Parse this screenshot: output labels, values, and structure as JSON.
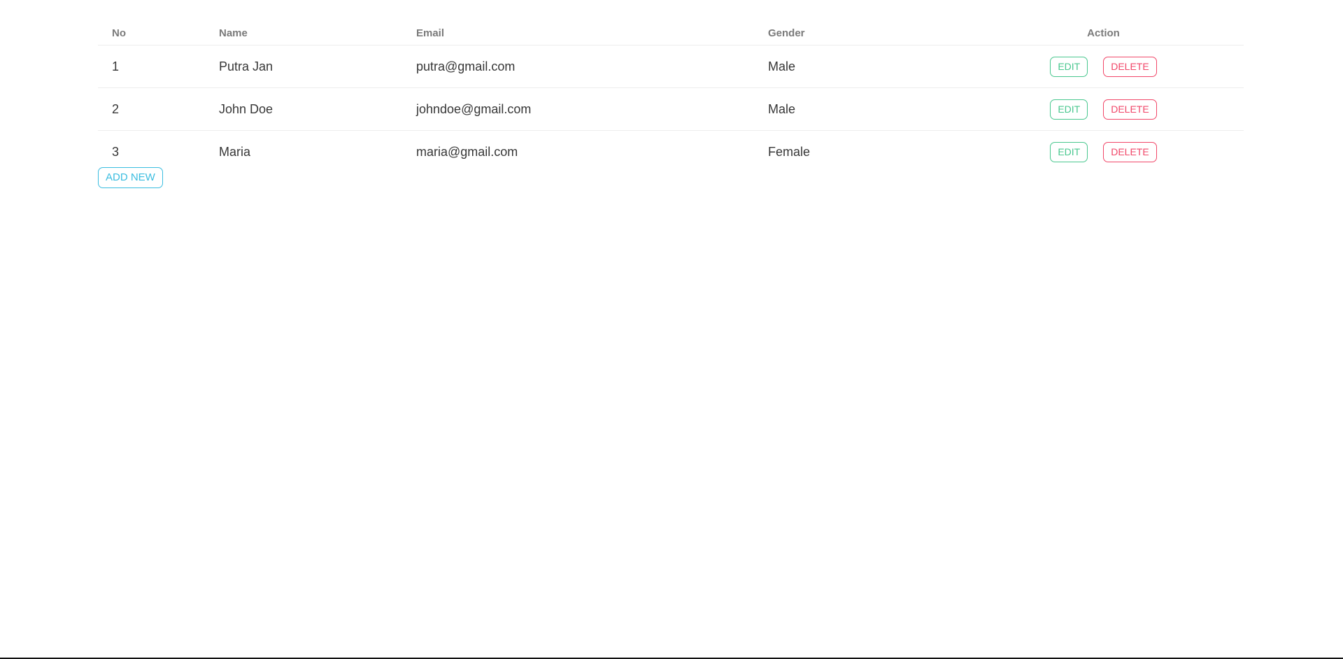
{
  "table": {
    "headers": {
      "no": "No",
      "name": "Name",
      "email": "Email",
      "gender": "Gender",
      "action": "Action"
    },
    "rows": [
      {
        "no": "1",
        "name": "Putra Jan",
        "email": "putra@gmail.com",
        "gender": "Male",
        "edit_label": "EDIT",
        "delete_label": "DELETE"
      },
      {
        "no": "2",
        "name": "John Doe",
        "email": "johndoe@gmail.com",
        "gender": "Male",
        "edit_label": "EDIT",
        "delete_label": "DELETE"
      },
      {
        "no": "3",
        "name": "Maria",
        "email": "maria@gmail.com",
        "gender": "Female",
        "edit_label": "EDIT",
        "delete_label": "DELETE"
      }
    ]
  },
  "actions": {
    "add_new_label": "ADD NEW"
  },
  "colors": {
    "edit": "#48c78e",
    "delete": "#f14668",
    "add_new": "#3abde0",
    "header_text": "#7a7a7a"
  }
}
